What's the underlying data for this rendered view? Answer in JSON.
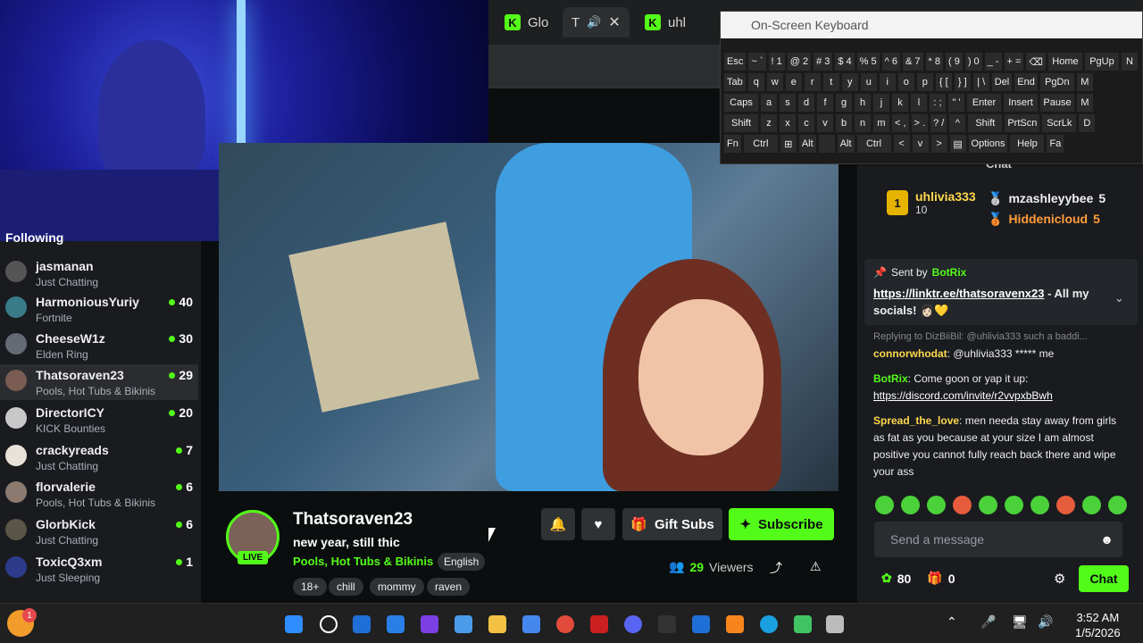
{
  "browser": {
    "tabs": [
      {
        "label": "Glo"
      },
      {
        "label": "T"
      },
      {
        "label": "uhl"
      }
    ]
  },
  "sidebar": {
    "header": "Following",
    "channels": [
      {
        "name": "jasmanan",
        "category": "Just Chatting",
        "viewers": ""
      },
      {
        "name": "HarmoniousYuriy",
        "category": "Fortnite",
        "viewers": "40"
      },
      {
        "name": "CheeseW1z",
        "category": "Elden Ring",
        "viewers": "30"
      },
      {
        "name": "Thatsoraven23",
        "category": "Pools, Hot Tubs & Bikinis",
        "viewers": "29"
      },
      {
        "name": "DirectorICY",
        "category": "KICK Bounties",
        "viewers": "20"
      },
      {
        "name": "crackyreads",
        "category": "Just Chatting",
        "viewers": "7"
      },
      {
        "name": "florvalerie",
        "category": "Pools, Hot Tubs & Bikinis",
        "viewers": "6"
      },
      {
        "name": "GlorbKick",
        "category": "Just Chatting",
        "viewers": "6"
      },
      {
        "name": "ToxicQ3xm",
        "category": "Just Sleeping",
        "viewers": "1"
      }
    ]
  },
  "stream": {
    "name": "Thatsoraven23",
    "title": "new year, still thic",
    "category": "Pools, Hot Tubs & Bikinis",
    "language": "English",
    "live_label": "LIVE",
    "tags": [
      "18+",
      "chill",
      "mommy",
      "raven"
    ],
    "viewers_count": "29",
    "viewers_label": "Viewers",
    "gift_label": "Gift Subs",
    "subscribe_label": "Subscribe"
  },
  "chat": {
    "leaderboard": {
      "rank1": {
        "rank": "1",
        "name": "uhlivia333",
        "count": "10"
      },
      "rank2": {
        "name": "mzashleyybee",
        "count": "5"
      },
      "rank3": {
        "name": "Hiddenicloud",
        "count": "5"
      }
    },
    "pinned": {
      "sent_by_label": "Sent by",
      "sender": "BotRix",
      "link": "https://linktr.ee/thatsoravenx23",
      "text": " - All my socials! 👩🏻💛"
    },
    "messages": [
      {
        "reply_to": "Replying to DizBiiBil: @uhlivia333 such a baddi...",
        "user": "connorwhodat",
        "user_color": "#ffd84d",
        "text": ": @uhlivia333 ***** me"
      },
      {
        "user": "BotRix",
        "user_color": "#53fc18",
        "text": ": Come goon or yap it up: ",
        "link": "https://discord.com/invite/r2vvpxbBwh"
      },
      {
        "user": "Spread_the_love",
        "user_color": "#ffd84d",
        "text": ": men needa stay away from girls as fat as you because at your size I am almost positive you cannot fully reach back there and wipe your ass"
      }
    ],
    "input_placeholder": "Send a message",
    "points": "80",
    "gift_count": "0",
    "chat_button": "Chat",
    "header": "Chat"
  },
  "osk": {
    "title": "On-Screen Keyboard",
    "rows": [
      [
        "Esc",
        "~ `",
        "! 1",
        "@ 2",
        "# 3",
        "$ 4",
        "% 5",
        "^ 6",
        "& 7",
        "* 8",
        "( 9",
        ") 0",
        "_ -",
        "+ =",
        "⌫",
        "Home",
        "PgUp",
        "N"
      ],
      [
        "Tab",
        "q",
        "w",
        "e",
        "r",
        "t",
        "y",
        "u",
        "i",
        "o",
        "p",
        "{ [",
        "} ]",
        "| \\",
        "Del",
        "End",
        "PgDn",
        "M"
      ],
      [
        "Caps",
        "a",
        "s",
        "d",
        "f",
        "g",
        "h",
        "j",
        "k",
        "l",
        ": ;",
        "\" '",
        "Enter",
        "Insert",
        "Pause",
        "M"
      ],
      [
        "Shift",
        "z",
        "x",
        "c",
        "v",
        "b",
        "n",
        "m",
        "< ,",
        "> .",
        "? /",
        "^",
        "Shift",
        "PrtScn",
        "ScrLk",
        "D"
      ],
      [
        "Fn",
        "Ctrl",
        "⊞",
        "Alt",
        "",
        "Alt",
        "Ctrl",
        "<",
        "v",
        ">",
        "▤",
        "Options",
        "Help",
        "Fa"
      ]
    ]
  },
  "taskbar": {
    "time": "3:52 AM",
    "date": "1/5/2026",
    "notification_badge": "1"
  }
}
